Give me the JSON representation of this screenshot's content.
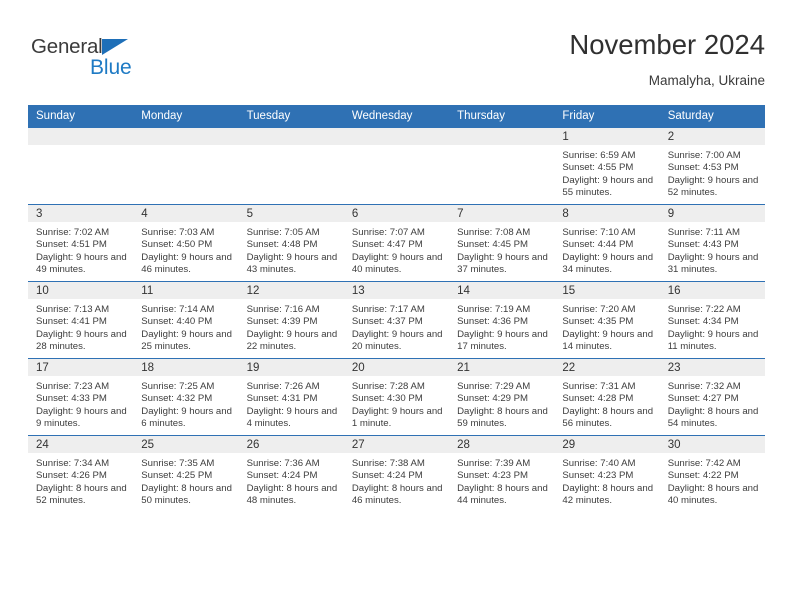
{
  "logo": {
    "text_top": "General",
    "text_bottom": "Blue",
    "accent_color": "#1e7ac4"
  },
  "header": {
    "title": "November 2024",
    "subtitle": "Mamalyha, Ukraine"
  },
  "theme": {
    "header_bg": "#2f71b4",
    "daynum_bg": "#eeeeee",
    "divider": "#2f71b4"
  },
  "weekday_headers": [
    "Sunday",
    "Monday",
    "Tuesday",
    "Wednesday",
    "Thursday",
    "Friday",
    "Saturday"
  ],
  "labels": {
    "sunrise_prefix": "Sunrise:",
    "sunset_prefix": "Sunset:",
    "daylight_prefix": "Daylight:"
  },
  "weeks": [
    [
      {
        "day": ""
      },
      {
        "day": ""
      },
      {
        "day": ""
      },
      {
        "day": ""
      },
      {
        "day": ""
      },
      {
        "day": "1",
        "sunrise": "Sunrise: 6:59 AM",
        "sunset": "Sunset: 4:55 PM",
        "daylight": "Daylight: 9 hours and 55 minutes."
      },
      {
        "day": "2",
        "sunrise": "Sunrise: 7:00 AM",
        "sunset": "Sunset: 4:53 PM",
        "daylight": "Daylight: 9 hours and 52 minutes."
      }
    ],
    [
      {
        "day": "3",
        "sunrise": "Sunrise: 7:02 AM",
        "sunset": "Sunset: 4:51 PM",
        "daylight": "Daylight: 9 hours and 49 minutes."
      },
      {
        "day": "4",
        "sunrise": "Sunrise: 7:03 AM",
        "sunset": "Sunset: 4:50 PM",
        "daylight": "Daylight: 9 hours and 46 minutes."
      },
      {
        "day": "5",
        "sunrise": "Sunrise: 7:05 AM",
        "sunset": "Sunset: 4:48 PM",
        "daylight": "Daylight: 9 hours and 43 minutes."
      },
      {
        "day": "6",
        "sunrise": "Sunrise: 7:07 AM",
        "sunset": "Sunset: 4:47 PM",
        "daylight": "Daylight: 9 hours and 40 minutes."
      },
      {
        "day": "7",
        "sunrise": "Sunrise: 7:08 AM",
        "sunset": "Sunset: 4:45 PM",
        "daylight": "Daylight: 9 hours and 37 minutes."
      },
      {
        "day": "8",
        "sunrise": "Sunrise: 7:10 AM",
        "sunset": "Sunset: 4:44 PM",
        "daylight": "Daylight: 9 hours and 34 minutes."
      },
      {
        "day": "9",
        "sunrise": "Sunrise: 7:11 AM",
        "sunset": "Sunset: 4:43 PM",
        "daylight": "Daylight: 9 hours and 31 minutes."
      }
    ],
    [
      {
        "day": "10",
        "sunrise": "Sunrise: 7:13 AM",
        "sunset": "Sunset: 4:41 PM",
        "daylight": "Daylight: 9 hours and 28 minutes."
      },
      {
        "day": "11",
        "sunrise": "Sunrise: 7:14 AM",
        "sunset": "Sunset: 4:40 PM",
        "daylight": "Daylight: 9 hours and 25 minutes."
      },
      {
        "day": "12",
        "sunrise": "Sunrise: 7:16 AM",
        "sunset": "Sunset: 4:39 PM",
        "daylight": "Daylight: 9 hours and 22 minutes."
      },
      {
        "day": "13",
        "sunrise": "Sunrise: 7:17 AM",
        "sunset": "Sunset: 4:37 PM",
        "daylight": "Daylight: 9 hours and 20 minutes."
      },
      {
        "day": "14",
        "sunrise": "Sunrise: 7:19 AM",
        "sunset": "Sunset: 4:36 PM",
        "daylight": "Daylight: 9 hours and 17 minutes."
      },
      {
        "day": "15",
        "sunrise": "Sunrise: 7:20 AM",
        "sunset": "Sunset: 4:35 PM",
        "daylight": "Daylight: 9 hours and 14 minutes."
      },
      {
        "day": "16",
        "sunrise": "Sunrise: 7:22 AM",
        "sunset": "Sunset: 4:34 PM",
        "daylight": "Daylight: 9 hours and 11 minutes."
      }
    ],
    [
      {
        "day": "17",
        "sunrise": "Sunrise: 7:23 AM",
        "sunset": "Sunset: 4:33 PM",
        "daylight": "Daylight: 9 hours and 9 minutes."
      },
      {
        "day": "18",
        "sunrise": "Sunrise: 7:25 AM",
        "sunset": "Sunset: 4:32 PM",
        "daylight": "Daylight: 9 hours and 6 minutes."
      },
      {
        "day": "19",
        "sunrise": "Sunrise: 7:26 AM",
        "sunset": "Sunset: 4:31 PM",
        "daylight": "Daylight: 9 hours and 4 minutes."
      },
      {
        "day": "20",
        "sunrise": "Sunrise: 7:28 AM",
        "sunset": "Sunset: 4:30 PM",
        "daylight": "Daylight: 9 hours and 1 minute."
      },
      {
        "day": "21",
        "sunrise": "Sunrise: 7:29 AM",
        "sunset": "Sunset: 4:29 PM",
        "daylight": "Daylight: 8 hours and 59 minutes."
      },
      {
        "day": "22",
        "sunrise": "Sunrise: 7:31 AM",
        "sunset": "Sunset: 4:28 PM",
        "daylight": "Daylight: 8 hours and 56 minutes."
      },
      {
        "day": "23",
        "sunrise": "Sunrise: 7:32 AM",
        "sunset": "Sunset: 4:27 PM",
        "daylight": "Daylight: 8 hours and 54 minutes."
      }
    ],
    [
      {
        "day": "24",
        "sunrise": "Sunrise: 7:34 AM",
        "sunset": "Sunset: 4:26 PM",
        "daylight": "Daylight: 8 hours and 52 minutes."
      },
      {
        "day": "25",
        "sunrise": "Sunrise: 7:35 AM",
        "sunset": "Sunset: 4:25 PM",
        "daylight": "Daylight: 8 hours and 50 minutes."
      },
      {
        "day": "26",
        "sunrise": "Sunrise: 7:36 AM",
        "sunset": "Sunset: 4:24 PM",
        "daylight": "Daylight: 8 hours and 48 minutes."
      },
      {
        "day": "27",
        "sunrise": "Sunrise: 7:38 AM",
        "sunset": "Sunset: 4:24 PM",
        "daylight": "Daylight: 8 hours and 46 minutes."
      },
      {
        "day": "28",
        "sunrise": "Sunrise: 7:39 AM",
        "sunset": "Sunset: 4:23 PM",
        "daylight": "Daylight: 8 hours and 44 minutes."
      },
      {
        "day": "29",
        "sunrise": "Sunrise: 7:40 AM",
        "sunset": "Sunset: 4:23 PM",
        "daylight": "Daylight: 8 hours and 42 minutes."
      },
      {
        "day": "30",
        "sunrise": "Sunrise: 7:42 AM",
        "sunset": "Sunset: 4:22 PM",
        "daylight": "Daylight: 8 hours and 40 minutes."
      }
    ]
  ]
}
